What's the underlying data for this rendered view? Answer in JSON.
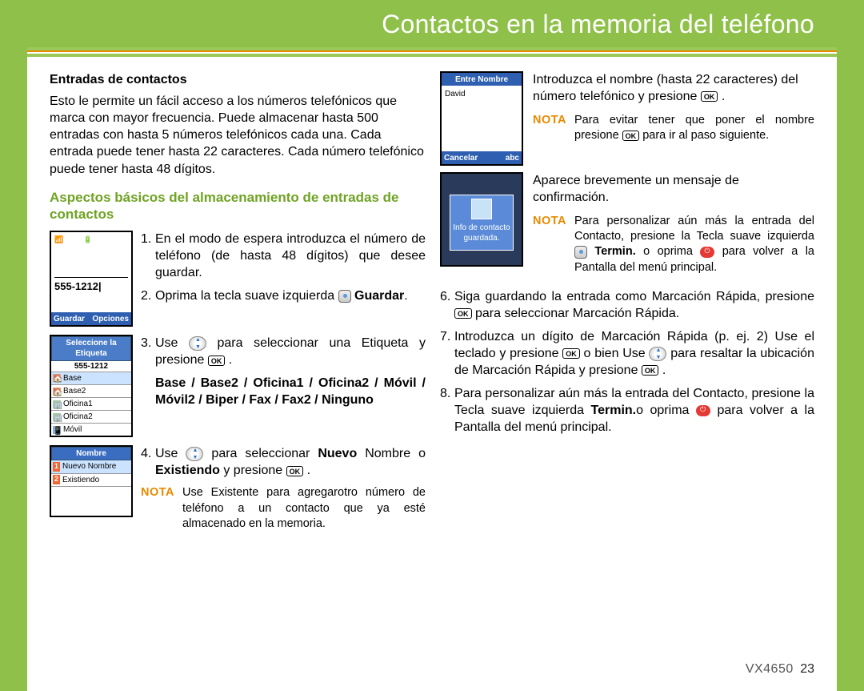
{
  "title": "Contactos en la memoria del teléfono",
  "section_heading": "Entradas de contactos",
  "intro": "Esto le permite un fácil acceso a los números telefónicos que marca con mayor frecuencia. Puede almacenar hasta 500 entradas con hasta 5 números telefónicos cada una. Cada entrada puede tener hasta 22 caracteres. Cada número telefónico puede tener hasta 48 dígitos.",
  "green_heading": "Aspectos básicos del almacenamiento de entradas de contactos",
  "phone1": {
    "number": "555-1212|",
    "left_soft": "Guardar",
    "right_soft": "Opciones"
  },
  "phone2": {
    "title": "Seleccione la Etiqueta",
    "number": "555-1212",
    "rows": [
      "Base",
      "Base2",
      "Oficina1",
      "Oficina2",
      "Móvil"
    ]
  },
  "phone3": {
    "title": "Nombre",
    "rows": [
      "Nuevo Nombre",
      "Existiendo"
    ]
  },
  "steps_left": {
    "s1": "En el modo de espera introduzca el número de teléfono (de hasta 48 dígitos) que desee guardar.",
    "s2_a": "Oprima la tecla suave izquierda ",
    "s2_b": "Guardar",
    "s3_a": "Use ",
    "s3_b": " para seleccionar una Etiqueta y presione ",
    "labels": "Base / Base2 / Oficina1 / Oficina2 / Móvil / Móvil2 / Biper / Fax / Fax2 / Ninguno",
    "s4_a": "Use ",
    "s4_b": " para seleccionar ",
    "s4_nuevo": "Nuevo",
    "s4_c": " Nombre o ",
    "s4_exist": "Existiendo",
    "s4_d": " y presione "
  },
  "nota1": {
    "label": "NOTA",
    "text": "Use Existente para agregarotro número de teléfono a un contacto que ya esté almacenado en la memoria."
  },
  "phone4": {
    "title": "Entre Nombre",
    "value": "David",
    "left_soft": "Cancelar",
    "right_soft": "abc"
  },
  "phone5": {
    "msg1": "Info de contacto",
    "msg2": "guardada."
  },
  "s5_a": "Introduzca el nombre (hasta 22 caracteres) del número telefónico y presione ",
  "nota2": {
    "label": "NOTA",
    "text_a": "Para evitar tener que poner el nombre presione ",
    "text_b": " para ir al paso siguiente."
  },
  "confirm": "Aparece brevemente un mensaje de confirmación.",
  "nota3": {
    "label": "NOTA",
    "text_a": "Para personalizar aún más la entrada del Contacto, presione la Tecla suave izquierda ",
    "termin": "Termin.",
    "text_b": " o oprima ",
    "text_c": " para volver a la Pantalla del menú principal."
  },
  "s6_a": "Siga guardando la entrada como Marcación Rápida, presione ",
  "s6_b": " para seleccionar Marcación Rápida.",
  "s7_a": "Introduzca un dígito de Marcación Rápida (p. ej. 2) Use el teclado y presione ",
  "s7_b": " o bien Use ",
  "s7_c": " para resaltar la ubicación de Marcación Rápida y presione ",
  "s8_a": "Para personalizar aún más la entrada del Contacto, presione la Tecla suave izquierda ",
  "s8_termin": "Termin.",
  "s8_b": "o oprima ",
  "s8_c": " para volver a la Pantalla del menú principal.",
  "ok_label": "OK",
  "footer_model": "VX4650",
  "footer_page": "23"
}
